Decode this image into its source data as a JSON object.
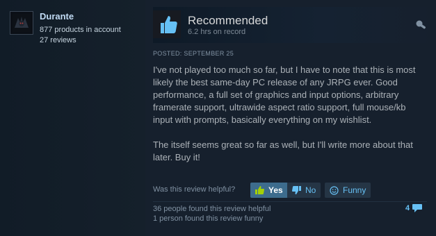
{
  "author": {
    "name": "Durante",
    "products": "877 products in account",
    "reviews": "27 reviews"
  },
  "review": {
    "rating": "Recommended",
    "hours": "6.2 hrs on record",
    "posted": "POSTED: SEPTEMBER 25",
    "paragraphs": [
      "I've not played too much so far, but I have to note that this is most likely the best same-day PC release of any JRPG ever. Good performance, a full set of graphics and input options, arbitrary framerate support, ultrawide aspect ratio support, full mouse/kb input with prompts, basically everything on my wishlist.",
      "The itself seems great so far as well, but I'll write more about that later. Buy it!"
    ]
  },
  "feedback": {
    "question": "Was this review helpful?",
    "yes_label": "Yes",
    "no_label": "No",
    "funny_label": "Funny",
    "helpful_count_text": "36 people found this review helpful",
    "funny_count_text": "1 person found this review funny",
    "comment_count": "4"
  },
  "colors": {
    "background": "#1b2838",
    "accent": "#67c1f5",
    "yes_button": "#3d6c8d",
    "thumb_icon": "#66c0f4"
  },
  "icons": {
    "thumb": "thumbs-up-icon",
    "product": "game-controller-icon",
    "yes": "thumbs-up-icon",
    "no": "thumbs-down-icon",
    "funny": "smiley-icon",
    "comments": "speech-bubble-icon"
  }
}
